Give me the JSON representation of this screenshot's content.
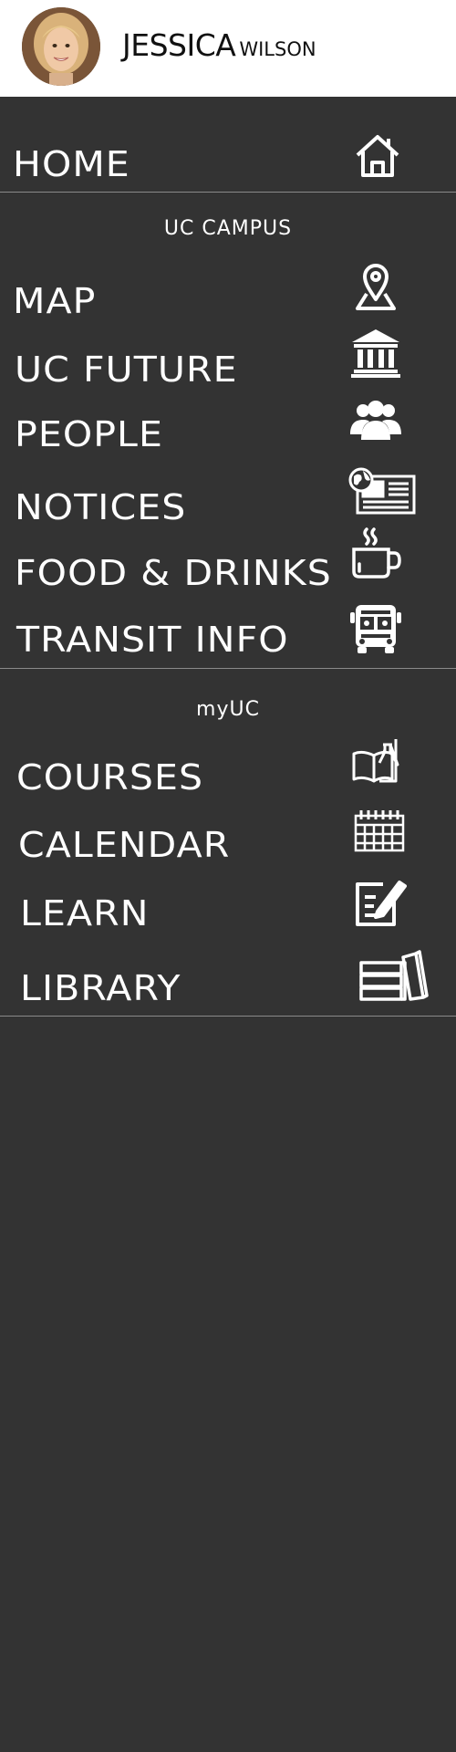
{
  "user": {
    "first_name": "JESSICA",
    "last_name": "WILSON"
  },
  "home": {
    "label": "HOME",
    "icon": "home-icon"
  },
  "campus": {
    "title": "UC CAMPUS",
    "items": [
      {
        "label": "MAP",
        "icon": "map-pin-icon"
      },
      {
        "label": "UC FUTURE",
        "icon": "institution-icon"
      },
      {
        "label": "PEOPLE",
        "icon": "people-icon"
      },
      {
        "label": "NOTICES",
        "icon": "newspaper-icon"
      },
      {
        "label": "FOOD & DRINKS",
        "icon": "coffee-cup-icon"
      },
      {
        "label": "TRANSIT INFO",
        "icon": "bus-icon"
      }
    ]
  },
  "myuc": {
    "title": "myUC",
    "items": [
      {
        "label": "COURSES",
        "icon": "book-flask-icon"
      },
      {
        "label": "CALENDAR",
        "icon": "calendar-icon"
      },
      {
        "label": "LEARN",
        "icon": "edit-pencil-icon"
      },
      {
        "label": "LIBRARY",
        "icon": "books-icon"
      }
    ]
  },
  "colors": {
    "background": "#333333",
    "header": "#ffffff",
    "text": "#ffffff",
    "divider": "#8a8a8a"
  }
}
